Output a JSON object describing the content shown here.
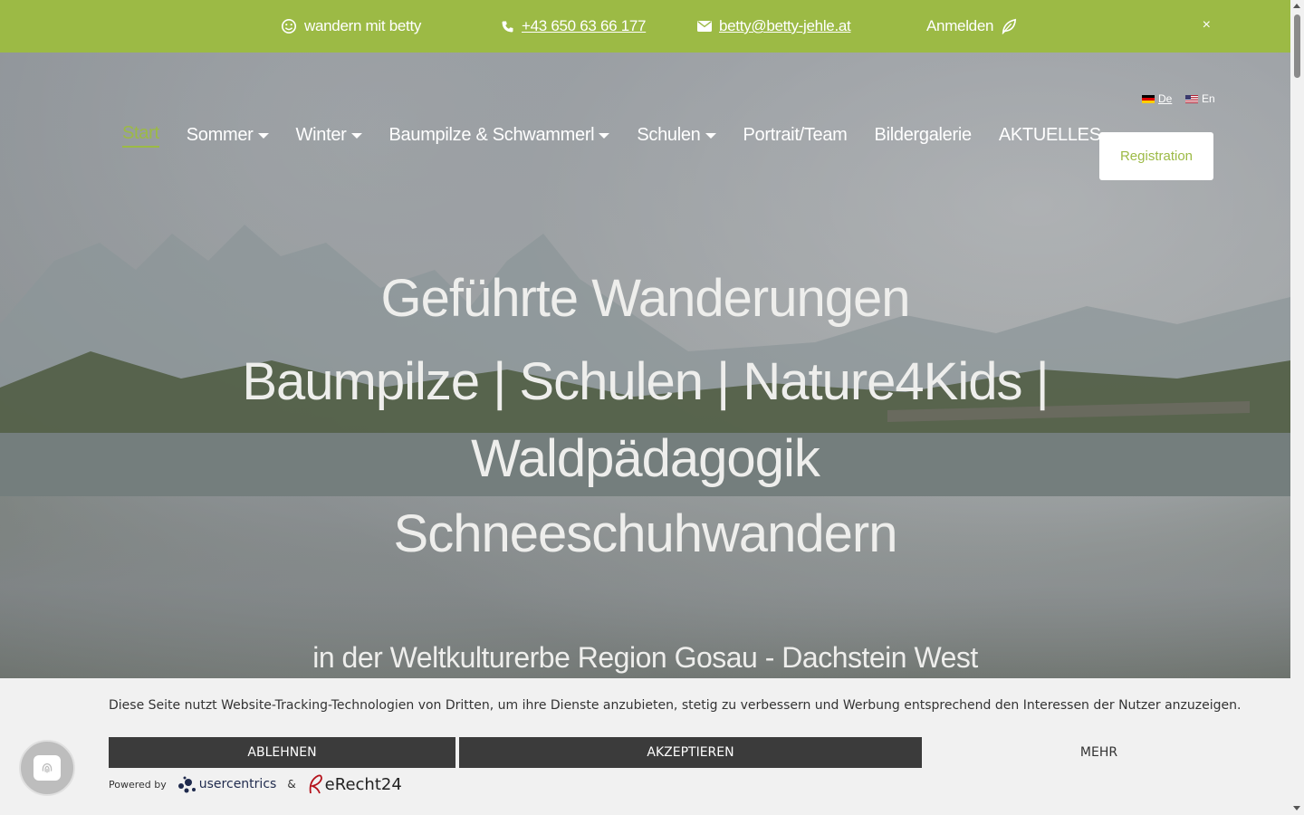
{
  "topbar": {
    "tagline": "wandern mit betty",
    "phone": "+43 650 63 66 177",
    "email": "betty@betty-jehle.at",
    "login": "Anmelden",
    "close": "×"
  },
  "nav": {
    "items": [
      {
        "label": "Start",
        "active": true
      },
      {
        "label": "Sommer",
        "dropdown": true
      },
      {
        "label": "Winter",
        "dropdown": true
      },
      {
        "label": "Baumpilze & Schwammerl",
        "dropdown": true
      },
      {
        "label": "Schulen",
        "dropdown": true
      },
      {
        "label": "Portrait/Team"
      },
      {
        "label": "Bildergalerie"
      },
      {
        "label": "AKTUELLES"
      }
    ]
  },
  "languages": {
    "de": "De",
    "en": "En"
  },
  "registration": "Registration",
  "hero": {
    "line1": "Geführte Wanderungen",
    "line2": "Baumpilze | Schulen | Nature4Kids |",
    "line3": "Waldpädagogik",
    "line4": "Schneeschuhwandern",
    "subline": "in der Weltkulturerbe Region Gosau - Dachstein West"
  },
  "cookie": {
    "message": "Diese Seite nutzt Website-Tracking-Technologien von Dritten, um ihre Dienste anzubieten, stetig zu verbessern und Werbung entsprechend den Interessen der Nutzer anzuzeigen.",
    "decline": "ABLEHNEN",
    "accept": "AKZEPTIEREN",
    "more": "MEHR",
    "powered_by": "Powered by",
    "usercentrics": "usercentrics",
    "amp": "&",
    "erecht": "eRecht24"
  },
  "colors": {
    "accent": "#9cba45",
    "banner": "#f1f1f1",
    "dark_button": "#3b3b3b"
  }
}
